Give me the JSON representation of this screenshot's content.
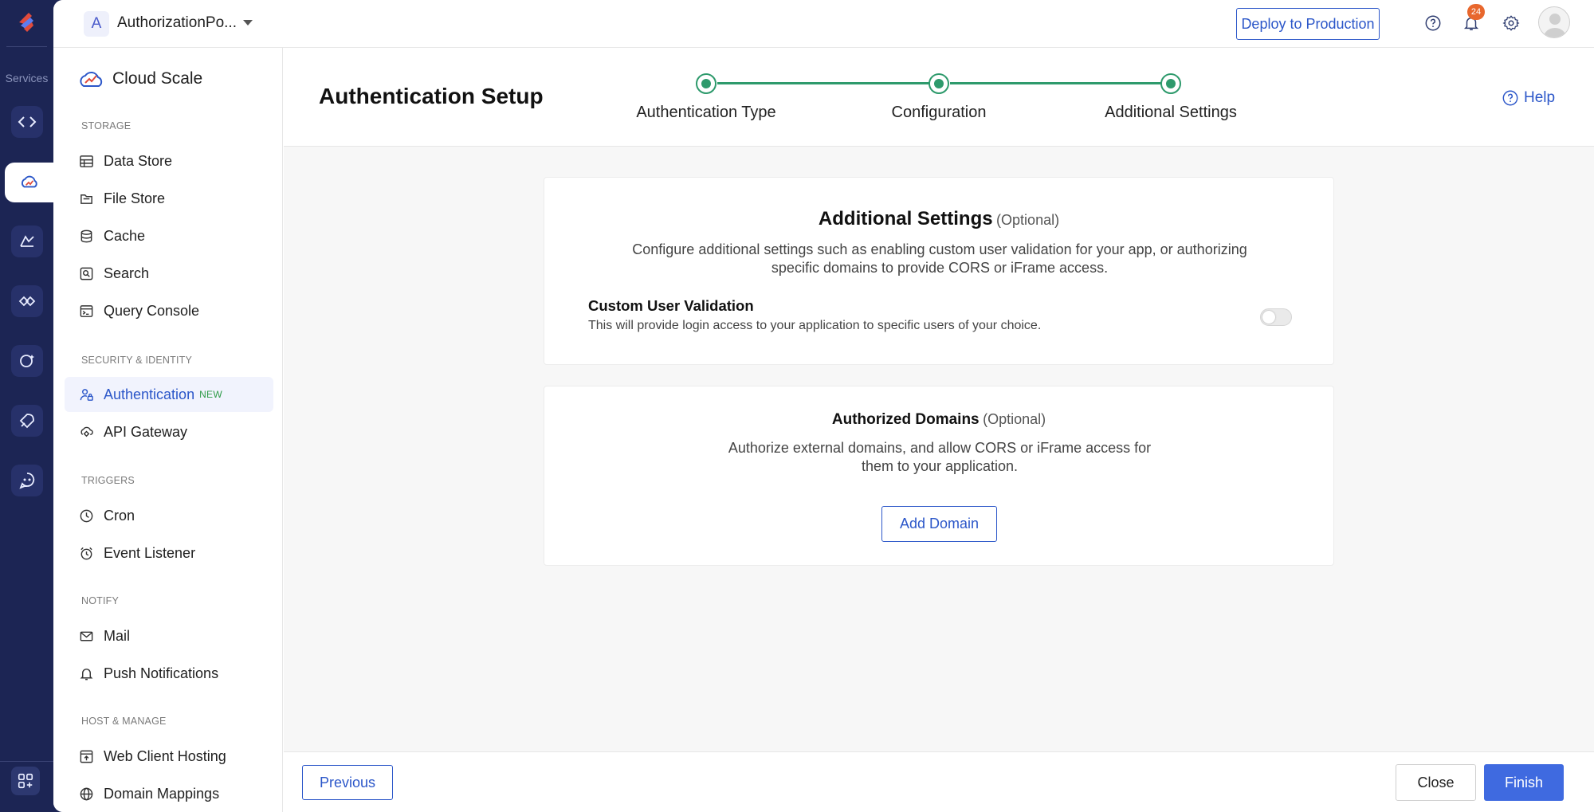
{
  "rail": {
    "services_label": "Services",
    "items": [
      "code-icon",
      "cloud-scale-icon",
      "serverless-icon",
      "devops-icon",
      "ai-icon",
      "launch-icon",
      "bot-icon"
    ],
    "apps_icon": "apps-icon"
  },
  "topbar": {
    "project_initial": "A",
    "project_name": "AuthorizationPo...",
    "deploy_label": "Deploy to Production",
    "notification_count": "24"
  },
  "sidebar": {
    "brand": "Cloud Scale",
    "sections": {
      "storage": "STORAGE",
      "security": "SECURITY & IDENTITY",
      "triggers": "TRIGGERS",
      "notify": "NOTIFY",
      "host": "HOST & MANAGE"
    },
    "items": {
      "data_store": "Data Store",
      "file_store": "File Store",
      "cache": "Cache",
      "search": "Search",
      "query_console": "Query Console",
      "authentication": "Authentication",
      "authentication_tag": "NEW",
      "api_gateway": "API Gateway",
      "cron": "Cron",
      "event_listener": "Event Listener",
      "mail": "Mail",
      "push_notifications": "Push Notifications",
      "web_client_hosting": "Web Client Hosting",
      "domain_mappings": "Domain Mappings"
    }
  },
  "wizard": {
    "title": "Authentication Setup",
    "steps": [
      "Authentication Type",
      "Configuration",
      "Additional Settings"
    ],
    "help_label": "Help"
  },
  "additional_settings": {
    "title": "Additional Settings",
    "optional": "(Optional)",
    "desc_line1": "Configure additional settings such as enabling custom user validation for your app, or authorizing",
    "desc_line2": "specific domains to provide CORS or iFrame access.",
    "custom_validation_title": "Custom User Validation",
    "custom_validation_desc": "This will provide login access to your application to specific users of your choice.",
    "custom_validation_enabled": false
  },
  "authorized_domains": {
    "title": "Authorized Domains",
    "optional": "(Optional)",
    "desc_line1": "Authorize external domains, and allow CORS or iFrame access for",
    "desc_line2": "them to your application.",
    "add_label": "Add Domain"
  },
  "footer": {
    "previous_label": "Previous",
    "close_label": "Close",
    "finish_label": "Finish"
  },
  "colors": {
    "accent": "#2c57c9",
    "step_green": "#2e9a6c",
    "rail_bg": "#1c2554",
    "finish_bg": "#3f6ae0",
    "badge": "#e8672d"
  }
}
